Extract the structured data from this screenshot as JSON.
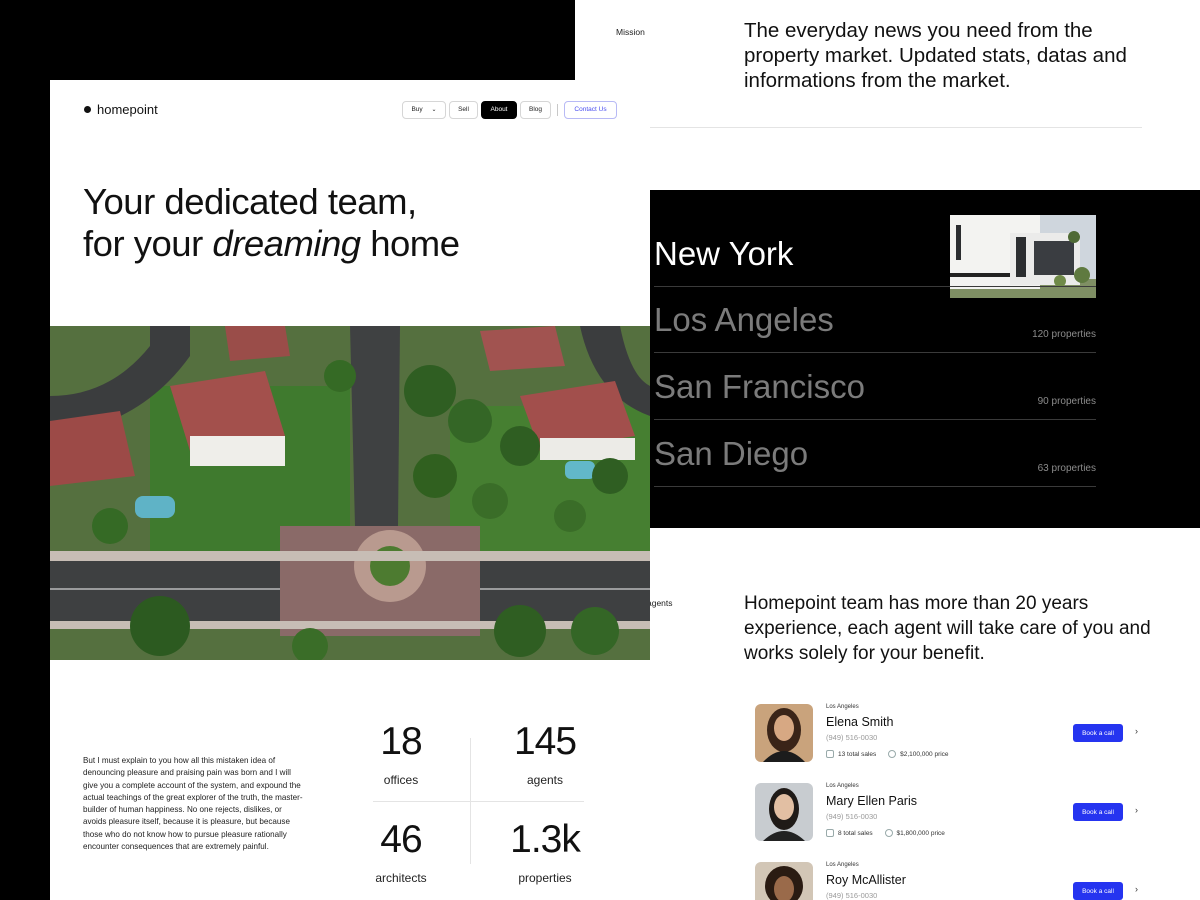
{
  "mission": {
    "label": "Mission",
    "text": "The everyday news you need from the property market. Updated stats, datas and informations from the market."
  },
  "cities": [
    {
      "name": "New York",
      "count": "",
      "active": true
    },
    {
      "name": "Los Angeles",
      "count": "120 properties"
    },
    {
      "name": "San Francisco",
      "count": "90 properties"
    },
    {
      "name": "San Diego",
      "count": "63 properties"
    }
  ],
  "agents_section": {
    "label": "agents",
    "text": "Homepoint team has more than 20 years experience, each agent will take care of you and works solely for your benefit."
  },
  "agents": [
    {
      "city": "Los Angeles",
      "name": "Elena Smith",
      "phone": "(949) 516-0030",
      "sales": "13 total sales",
      "price": "$2,100,000 price",
      "button": "Book a call"
    },
    {
      "city": "Los Angeles",
      "name": "Mary Ellen Paris",
      "phone": "(949) 516-0030",
      "sales": "8 total sales",
      "price": "$1,800,000 price",
      "button": "Book a call"
    },
    {
      "city": "Los Angeles",
      "name": "Roy McAllister",
      "phone": "(949) 516-0030",
      "sales": "",
      "price": "",
      "button": "Book a call"
    }
  ],
  "brand": {
    "name": "homepoint"
  },
  "nav": {
    "buy": "Buy",
    "sell": "Sell",
    "about": "About",
    "blog": "Blog",
    "contact": "Contact Us",
    "active": "About",
    "accent": "#2534f0"
  },
  "hero": {
    "line1": "Your dedicated team,",
    "line2_pre": "for your ",
    "line2_em": "dreaming",
    "line2_post": " home"
  },
  "about": {
    "text": "But I must explain to you how all this mistaken idea of denouncing pleasure and praising pain was born and I will give you a complete account of the system, and expound the actual teachings of the great explorer of the truth, the master-builder of human happiness. No one rejects, dislikes, or avoids pleasure itself, because it is pleasure, but because those who do not know how to pursue pleasure rationally encounter consequences that are extremely painful."
  },
  "stats": [
    {
      "value": "18",
      "label": "offices"
    },
    {
      "value": "145",
      "label": "agents"
    },
    {
      "value": "46",
      "label": "architects"
    },
    {
      "value": "1.3k",
      "label": "properties"
    }
  ]
}
